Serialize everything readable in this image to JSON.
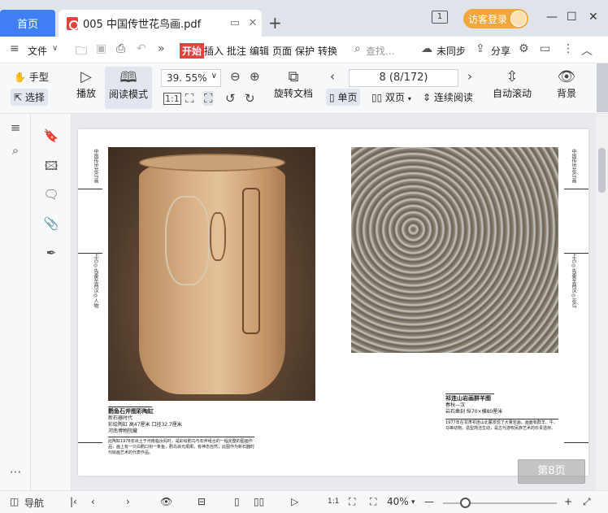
{
  "tabbar": {
    "home_label": "首页",
    "doc_title": "005 中国传世花鸟画.pdf",
    "new_tab": "+",
    "login_label": "访客登录",
    "notice_label": "1"
  },
  "menu": {
    "file_label": "文件",
    "items": [
      "开始",
      "插入",
      "批注",
      "编辑",
      "页面",
      "保护",
      "转换"
    ],
    "search_placeholder": "查找...",
    "sync_label": "未同步",
    "share_label": "分享"
  },
  "toolbar": {
    "hand_label": "手型",
    "select_label": "选择",
    "play_label": "播放",
    "read_mode_label": "阅读模式",
    "zoom_value": "39. 55%",
    "page_value": "8 (8/172)",
    "rotate_label": "旋转文档",
    "single_label": "单页",
    "double_label": "双页",
    "continuous_label": "连续阅读",
    "autoscroll_label": "自动滚动",
    "background_label": "背景"
  },
  "document": {
    "left_header": "中国传世花鸟画",
    "left_side_text": "上古◎先秦至两汉◎人物",
    "right_header": "中国传世花鸟画",
    "right_side_text": "上古◎先秦至两汉◎花鸟",
    "left_caption_title": "鹳鱼石斧图彩陶缸",
    "left_caption_sub": "新石器时代",
    "left_caption_meta": "彩绘陶缸 高47厘米 口径32.7厘米",
    "left_caption_loc": "河南博物院藏",
    "left_caption_body": "此陶缸1978年出土于河南临汝阎村，是彩绘鹳鸟与石斧组合的一幅完整的图画作品，画上有一只白鹳口衔一条鱼，鹳鸟目光炯炯，有神态自然，此图作为新石器时代绘画艺术的代表作品。",
    "right_caption_title": "祁连山岩画群羊图",
    "right_caption_sub": "春秋—汉",
    "right_caption_meta": "岩石凿刻 纵70×横80厘米",
    "right_caption_body": "1977年在甘肃祁连山北麓发现了大量岩画，画面有群羊、牛、马等动物，造型简洁生动，是古代游牧民族艺术的珍贵遗存。",
    "page_indicator": "第8页"
  },
  "statusbar": {
    "nav_label": "导航",
    "zoom_label": "40%"
  }
}
